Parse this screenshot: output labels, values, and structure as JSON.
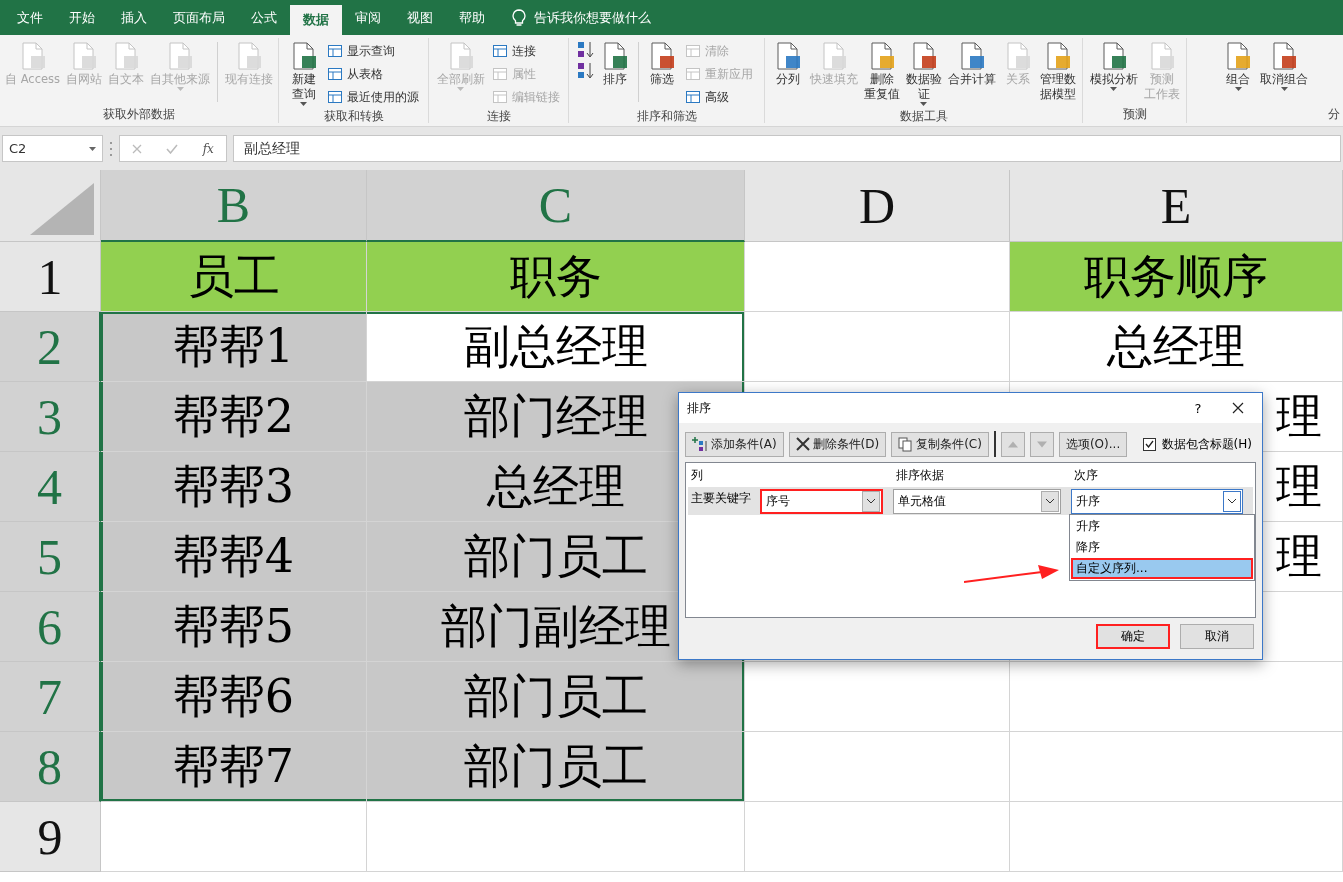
{
  "ribbon": {
    "tabs": [
      {
        "label": "文件",
        "selected": false
      },
      {
        "label": "开始",
        "selected": false
      },
      {
        "label": "插入",
        "selected": false
      },
      {
        "label": "页面布局",
        "selected": false
      },
      {
        "label": "公式",
        "selected": false
      },
      {
        "label": "数据",
        "selected": true
      },
      {
        "label": "审阅",
        "selected": false
      },
      {
        "label": "视图",
        "selected": false
      },
      {
        "label": "帮助",
        "selected": false
      }
    ],
    "tell_me": "告诉我你想要做什么",
    "groups": [
      {
        "label": "获取外部数据",
        "items": [
          {
            "kind": "large",
            "label": "自 Access",
            "disabled": true,
            "dropdown": false
          },
          {
            "kind": "large",
            "label": "自网站",
            "disabled": true,
            "dropdown": false
          },
          {
            "kind": "large",
            "label": "自文本",
            "disabled": true,
            "dropdown": false
          },
          {
            "kind": "large",
            "label": "自其他来源",
            "disabled": true,
            "dropdown": true
          },
          {
            "kind": "separator"
          },
          {
            "kind": "large",
            "label": "现有连接",
            "disabled": true,
            "dropdown": false
          }
        ]
      },
      {
        "label": "获取和转换",
        "items": [
          {
            "kind": "large",
            "label_lines": [
              "新建",
              "查询"
            ],
            "disabled": false,
            "dropdown": true
          },
          {
            "kind": "small",
            "label": "显示查询",
            "disabled": false
          },
          {
            "kind": "small",
            "label": "从表格",
            "disabled": false
          },
          {
            "kind": "small",
            "label": "最近使用的源",
            "disabled": false
          }
        ]
      },
      {
        "label": "连接",
        "items": [
          {
            "kind": "large",
            "label": "全部刷新",
            "disabled": true,
            "dropdown": true
          },
          {
            "kind": "small",
            "label": "连接",
            "disabled": false
          },
          {
            "kind": "small",
            "label": "属性",
            "disabled": true
          },
          {
            "kind": "small",
            "label": "编辑链接",
            "disabled": true
          }
        ]
      },
      {
        "label": "排序和筛选",
        "items": [
          {
            "kind": "sort-asc",
            "disabled": false
          },
          {
            "kind": "sort-desc",
            "disabled": false
          },
          {
            "kind": "large",
            "label": "排序",
            "disabled": false,
            "dropdown": false
          },
          {
            "kind": "separator"
          },
          {
            "kind": "large",
            "label": "筛选",
            "disabled": false,
            "dropdown": false
          },
          {
            "kind": "small",
            "label": "清除",
            "disabled": true
          },
          {
            "kind": "small",
            "label": "重新应用",
            "disabled": true
          },
          {
            "kind": "small",
            "label": "高级",
            "disabled": false
          }
        ]
      },
      {
        "label": "数据工具",
        "items": [
          {
            "kind": "large",
            "label": "分列",
            "disabled": false,
            "dropdown": false
          },
          {
            "kind": "large",
            "label": "快速填充",
            "disabled": true,
            "dropdown": false
          },
          {
            "kind": "large",
            "label_lines": [
              "删除",
              "重复值"
            ],
            "disabled": false,
            "dropdown": false
          },
          {
            "kind": "large",
            "label_lines": [
              "数据验",
              "证"
            ],
            "disabled": false,
            "dropdown": true
          },
          {
            "kind": "large",
            "label": "合并计算",
            "disabled": false,
            "dropdown": false
          },
          {
            "kind": "large",
            "label": "关系",
            "disabled": true,
            "dropdown": false
          },
          {
            "kind": "large",
            "label_lines": [
              "管理数",
              "据模型"
            ],
            "disabled": false,
            "dropdown": false
          }
        ]
      },
      {
        "label": "预测",
        "items": [
          {
            "kind": "large",
            "label": "模拟分析",
            "disabled": false,
            "dropdown": true
          },
          {
            "kind": "large",
            "label_lines": [
              "预测",
              "工作表"
            ],
            "disabled": true,
            "dropdown": false
          }
        ]
      },
      {
        "label": "分",
        "items": [
          {
            "kind": "large",
            "label": "组合",
            "disabled": false,
            "dropdown": true
          },
          {
            "kind": "large",
            "label": "取消组合",
            "disabled": false,
            "dropdown": true
          }
        ]
      }
    ]
  },
  "formula_bar": {
    "name_box": "C2",
    "function_label": "fx",
    "value": "副总经理"
  },
  "sheet": {
    "columns": [
      {
        "label": "B",
        "selected": true
      },
      {
        "label": "C",
        "selected": true
      },
      {
        "label": "D",
        "selected": false
      },
      {
        "label": "E",
        "selected": false
      }
    ],
    "rows": [
      {
        "label": "1",
        "selected": false,
        "cells": [
          {
            "text": "员工",
            "filled": true,
            "selected": false
          },
          {
            "text": "职务",
            "filled": true,
            "selected": false
          },
          {
            "filled": false,
            "selected": false
          },
          {
            "text": "职务顺序",
            "filled": true,
            "selected": false
          }
        ]
      },
      {
        "label": "2",
        "selected": true,
        "cells": [
          {
            "text": "帮帮1",
            "filled": false,
            "selected": true
          },
          {
            "text": "副总经理",
            "filled": false,
            "selected": true,
            "active": true
          },
          {
            "filled": false,
            "selected": false
          },
          {
            "text": "总经理",
            "filled": false,
            "selected": false
          }
        ]
      },
      {
        "label": "3",
        "selected": true,
        "cells": [
          {
            "text": "帮帮2",
            "filled": false,
            "selected": true
          },
          {
            "text": "部门经理",
            "filled": false,
            "selected": true
          },
          {},
          {
            "text": "理",
            "filled": false,
            "selected": false,
            "partial": true
          }
        ]
      },
      {
        "label": "4",
        "selected": true,
        "cells": [
          {
            "text": "帮帮3",
            "filled": false,
            "selected": true
          },
          {
            "text": "总经理",
            "filled": false,
            "selected": true
          },
          {},
          {
            "text": "理",
            "filled": false,
            "selected": false,
            "partial": true
          }
        ]
      },
      {
        "label": "5",
        "selected": true,
        "cells": [
          {
            "text": "帮帮4",
            "filled": false,
            "selected": true
          },
          {
            "text": "部门员工",
            "filled": false,
            "selected": true
          },
          {},
          {
            "text": "理",
            "filled": false,
            "selected": false,
            "partial": true
          }
        ]
      },
      {
        "label": "6",
        "selected": true,
        "cells": [
          {
            "text": "帮帮5",
            "filled": false,
            "selected": true
          },
          {
            "text": "部门副经理",
            "filled": false,
            "selected": true
          },
          {},
          {}
        ]
      },
      {
        "label": "7",
        "selected": true,
        "cells": [
          {
            "text": "帮帮6",
            "filled": false,
            "selected": true
          },
          {
            "text": "部门员工",
            "filled": false,
            "selected": true
          },
          {
            "filled": false,
            "selected": false
          },
          {
            "filled": false,
            "selected": false
          }
        ]
      },
      {
        "label": "8",
        "selected": true,
        "cells": [
          {
            "text": "帮帮7",
            "filled": false,
            "selected": true
          },
          {
            "text": "部门员工",
            "filled": false,
            "selected": true
          },
          {
            "filled": false,
            "selected": false
          },
          {
            "filled": false,
            "selected": false
          }
        ]
      },
      {
        "label": "9",
        "selected": false,
        "cells": [
          {
            "filled": false,
            "selected": false
          },
          {
            "filled": false,
            "selected": false
          },
          {
            "filled": false,
            "selected": false
          },
          {
            "filled": false,
            "selected": false
          }
        ]
      }
    ]
  },
  "dialog": {
    "title": "排序",
    "help": "?",
    "toolbar": [
      {
        "kind": "add",
        "label": "添加条件(A)",
        "disabled": false
      },
      {
        "kind": "delete",
        "label": "删除条件(D)",
        "disabled": false
      },
      {
        "kind": "copy",
        "label": "复制条件(C)",
        "disabled": false
      },
      {
        "kind": "move-up",
        "disabled": true
      },
      {
        "kind": "move-down",
        "disabled": true
      },
      {
        "kind": "options",
        "label": "选项(O)...",
        "disabled": false
      }
    ],
    "header_checkbox": {
      "label": "数据包含标题(H)",
      "checked": true
    },
    "columns": [
      "列",
      "排序依据",
      "次序"
    ],
    "rows": [
      {
        "label": "主要关键字",
        "selected": true,
        "column": {
          "value": "序号",
          "annotated": true
        },
        "sort_on": {
          "value": "单元格值",
          "annotated": false
        },
        "order": {
          "value": "升序",
          "annotated": false,
          "expanded": true
        }
      }
    ],
    "order_options": [
      {
        "label": "升序",
        "selected": false,
        "annotated": false
      },
      {
        "label": "降序",
        "selected": false,
        "annotated": false
      },
      {
        "label": "自定义序列...",
        "selected": true,
        "annotated": true
      }
    ],
    "annotation_arrow": true,
    "buttons": [
      {
        "label": "确定",
        "annotated": true
      },
      {
        "label": "取消",
        "annotated": false
      }
    ]
  }
}
